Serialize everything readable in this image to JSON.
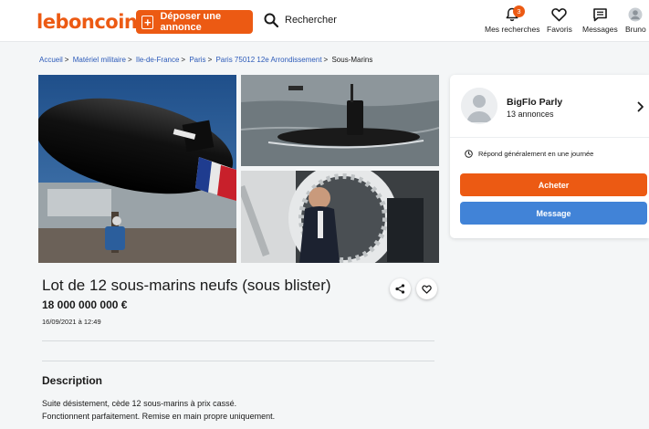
{
  "header": {
    "logo": "leboncoin",
    "deposit_label": "Déposer une annonce",
    "search_label": "Rechercher",
    "nav": [
      {
        "label": "Mes recherches",
        "icon": "bell-icon",
        "badge": "3"
      },
      {
        "label": "Favoris",
        "icon": "heart-icon"
      },
      {
        "label": "Messages",
        "icon": "message-icon"
      },
      {
        "label": "Bruno",
        "icon": "user-avatar-icon"
      }
    ]
  },
  "breadcrumb": [
    "Accueil",
    "Matériel militaire",
    "Ile-de-France",
    "Paris",
    "Paris 75012 12e Arrondissement",
    "Sous-Marins"
  ],
  "ad": {
    "title": "Lot de 12 sous-marins neufs (sous blister)",
    "price": "18 000 000 000 €",
    "date": "16/09/2021 à 12:49",
    "description_title": "Description",
    "description_lines": [
      "Suite désistement, cède 12 sous-marins à prix cassé.",
      "Fonctionnent parfaitement. Remise en main propre uniquement."
    ]
  },
  "seller": {
    "name": "BigFlo Parly",
    "count": "13 annonces",
    "reply": "Répond généralement en une journée",
    "buy_label": "Acheter",
    "message_label": "Message"
  },
  "colors": {
    "brand": "#ec5a13",
    "link": "#2d5bb9",
    "message": "#4183d7"
  }
}
